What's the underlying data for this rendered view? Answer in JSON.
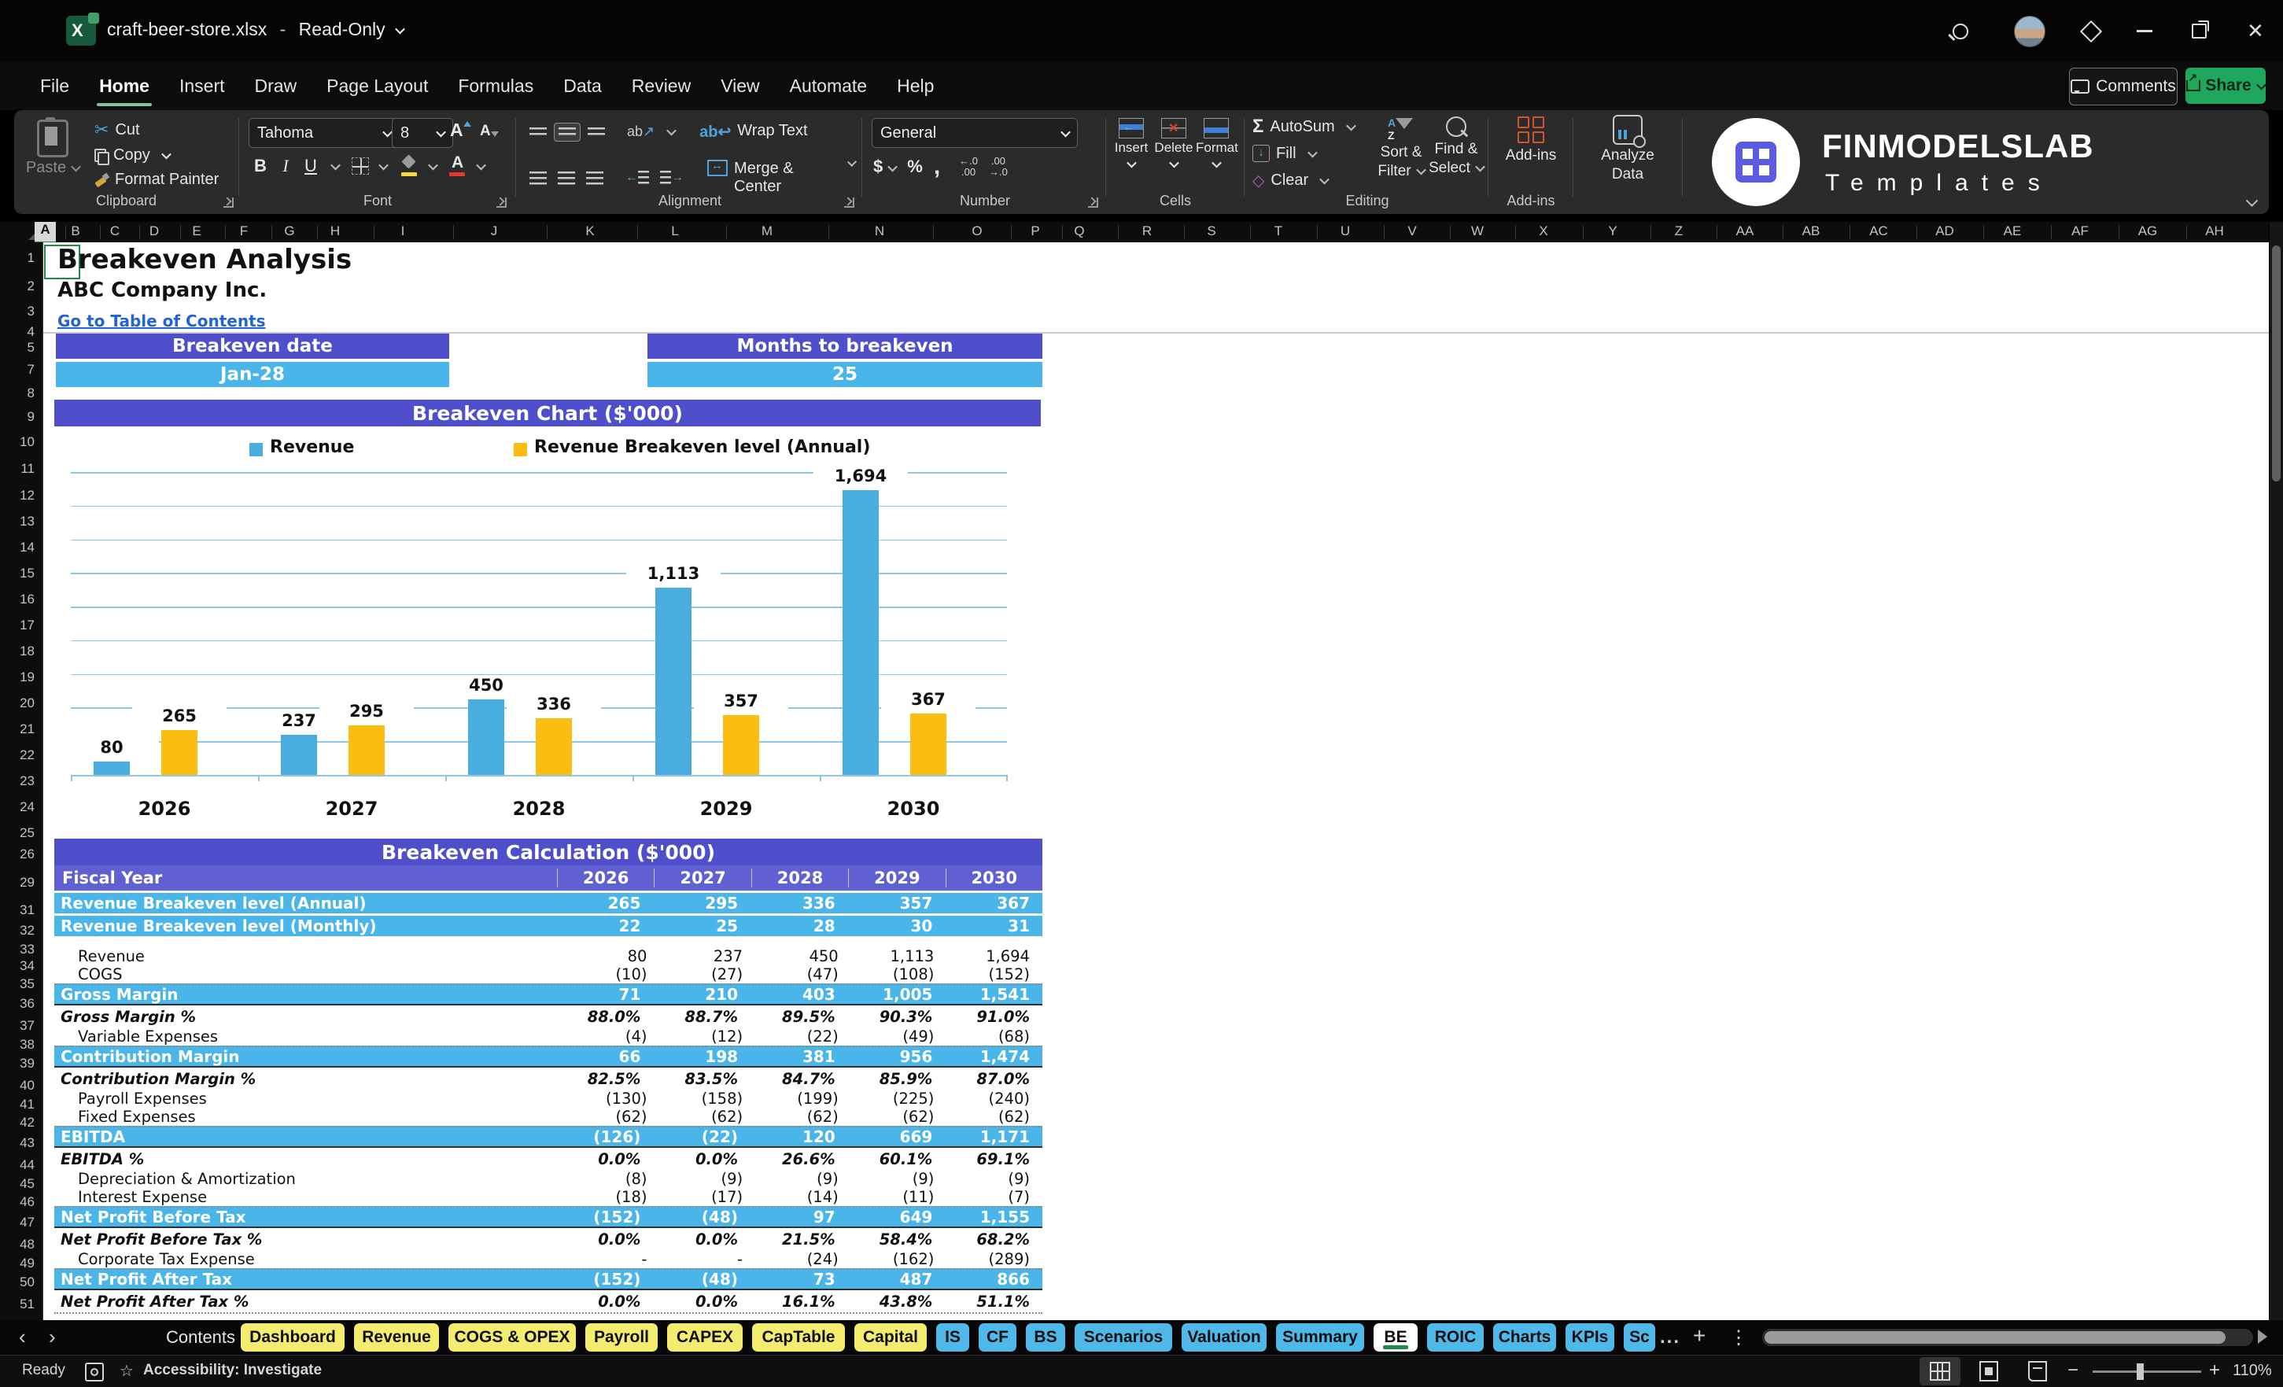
{
  "window": {
    "filename": "craft-beer-store.xlsx",
    "separator": "-",
    "mode": "Read-Only"
  },
  "menu_bar": {
    "items": [
      "File",
      "Home",
      "Insert",
      "Draw",
      "Page Layout",
      "Formulas",
      "Data",
      "Review",
      "View",
      "Automate",
      "Help"
    ],
    "active_item": "Home"
  },
  "quick_actions": {
    "comments_label": "Comments",
    "share_label": "Share"
  },
  "ribbon": {
    "clipboard": {
      "label": "Clipboard",
      "paste": "Paste",
      "cut": "Cut",
      "copy": "Copy",
      "format_painter": "Format Painter"
    },
    "font": {
      "label": "Font",
      "family": "Tahoma",
      "size": "8",
      "bold": "B",
      "italic": "I",
      "underline": "U"
    },
    "alignment": {
      "label": "Alignment",
      "wrap": "Wrap Text",
      "merge": "Merge & Center"
    },
    "number": {
      "label": "Number",
      "format": "General",
      "currency": "$",
      "percent": "%",
      "comma": ","
    },
    "cells": {
      "label": "Cells",
      "insert": "Insert",
      "delete": "Delete",
      "format": "Format"
    },
    "editing": {
      "label": "Editing",
      "autosum": "AutoSum",
      "fill": "Fill",
      "clear": "Clear",
      "sort_line1": "Sort &",
      "sort_line2": "Filter",
      "find_line1": "Find &",
      "find_line2": "Select"
    },
    "addins": {
      "label": "Add-ins",
      "addins": "Add-ins",
      "analyze_line1": "Analyze",
      "analyze_line2": "Data"
    }
  },
  "brand": {
    "name": "FINMODELSLAB",
    "subtitle": "Templates"
  },
  "grid": {
    "column_letters": [
      "A",
      "B",
      "C",
      "D",
      "E",
      "F",
      "G",
      "H",
      "I",
      "J",
      "K",
      "L",
      "M",
      "N",
      "O",
      "P",
      "Q",
      "R",
      "S",
      "T",
      "U",
      "V",
      "W",
      "X",
      "Y",
      "Z",
      "AA",
      "AB",
      "AC",
      "AD",
      "AE",
      "AF",
      "AG",
      "AH"
    ],
    "row_numbers": [
      1,
      2,
      3,
      4,
      5,
      7,
      8,
      9,
      10,
      11,
      12,
      13,
      14,
      15,
      16,
      17,
      18,
      19,
      20,
      21,
      22,
      23,
      24,
      25,
      26,
      29,
      31,
      32,
      33,
      34,
      35,
      36,
      37,
      38,
      39,
      40,
      41,
      42,
      43,
      44,
      45,
      46,
      47,
      48,
      49,
      50,
      51
    ]
  },
  "sheet": {
    "title": "Breakeven Analysis",
    "company": "ABC Company Inc.",
    "toc_link": "Go to Table of Contents",
    "kpis": [
      {
        "label": "Breakeven date",
        "value": "Jan-28"
      },
      {
        "label": "Months to breakeven",
        "value": "25"
      }
    ]
  },
  "chart_data": {
    "type": "bar",
    "title": "Breakeven Chart ($'000)",
    "categories": [
      "2026",
      "2027",
      "2028",
      "2029",
      "2030"
    ],
    "series": [
      {
        "name": "Revenue",
        "color": "#49ADE0",
        "values": [
          80,
          237,
          450,
          1113,
          1694
        ],
        "labels": [
          "80",
          "237",
          "450",
          "1,113",
          "1,694"
        ]
      },
      {
        "name": "Revenue Breakeven level (Annual)",
        "color": "#FBBE10",
        "values": [
          265,
          295,
          336,
          357,
          367
        ],
        "labels": [
          "265",
          "295",
          "336",
          "357",
          "367"
        ]
      }
    ],
    "ylim": [
      0,
      1800
    ],
    "gridline_step": 200,
    "grid": true,
    "legend_position": "top",
    "y_axis_labels": "hidden"
  },
  "calc_table": {
    "title": "Breakeven Calculation ($'000)",
    "header_label": "Fiscal Year",
    "years": [
      "2026",
      "2027",
      "2028",
      "2029",
      "2030"
    ],
    "band_rows": [
      {
        "label": "Revenue Breakeven level (Annual)",
        "values": [
          "265",
          "295",
          "336",
          "357",
          "367"
        ]
      },
      {
        "label": "Revenue Breakeven level (Monthly)",
        "values": [
          "22",
          "25",
          "28",
          "30",
          "31"
        ]
      }
    ],
    "rows": [
      {
        "label": "Revenue",
        "type": "detail",
        "values": [
          "80",
          "237",
          "450",
          "1,113",
          "1,694"
        ]
      },
      {
        "label": "COGS",
        "type": "detail",
        "values": [
          "(10)",
          "(27)",
          "(47)",
          "(108)",
          "(152)"
        ]
      },
      {
        "label": "Gross Margin",
        "type": "subtotal",
        "values": [
          "71",
          "210",
          "403",
          "1,005",
          "1,541"
        ]
      },
      {
        "label": "Gross Margin %",
        "type": "percent",
        "values": [
          "88.0%",
          "88.7%",
          "89.5%",
          "90.3%",
          "91.0%"
        ]
      },
      {
        "label": "Variable Expenses",
        "type": "detail",
        "values": [
          "(4)",
          "(12)",
          "(22)",
          "(49)",
          "(68)"
        ]
      },
      {
        "label": "Contribution Margin",
        "type": "subtotal",
        "values": [
          "66",
          "198",
          "381",
          "956",
          "1,474"
        ]
      },
      {
        "label": "Contribution Margin %",
        "type": "percent",
        "values": [
          "82.5%",
          "83.5%",
          "84.7%",
          "85.9%",
          "87.0%"
        ]
      },
      {
        "label": "Payroll Expenses",
        "type": "detail",
        "values": [
          "(130)",
          "(158)",
          "(199)",
          "(225)",
          "(240)"
        ]
      },
      {
        "label": "Fixed Expenses",
        "type": "detail",
        "values": [
          "(62)",
          "(62)",
          "(62)",
          "(62)",
          "(62)"
        ]
      },
      {
        "label": "EBITDA",
        "type": "subtotal",
        "values": [
          "(126)",
          "(22)",
          "120",
          "669",
          "1,171"
        ]
      },
      {
        "label": "EBITDA %",
        "type": "percent",
        "values": [
          "0.0%",
          "0.0%",
          "26.6%",
          "60.1%",
          "69.1%"
        ]
      },
      {
        "label": "Depreciation & Amortization",
        "type": "detail",
        "values": [
          "(8)",
          "(9)",
          "(9)",
          "(9)",
          "(9)"
        ]
      },
      {
        "label": "Interest Expense",
        "type": "detail",
        "values": [
          "(18)",
          "(17)",
          "(14)",
          "(11)",
          "(7)"
        ]
      },
      {
        "label": "Net Profit Before Tax",
        "type": "subtotal",
        "values": [
          "(152)",
          "(48)",
          "97",
          "649",
          "1,155"
        ]
      },
      {
        "label": "Net Profit Before Tax %",
        "type": "percent",
        "values": [
          "0.0%",
          "0.0%",
          "21.5%",
          "58.4%",
          "68.2%"
        ]
      },
      {
        "label": "Corporate Tax Expense",
        "type": "detail",
        "values": [
          "-",
          "-",
          "(24)",
          "(162)",
          "(289)"
        ]
      },
      {
        "label": "Net Profit After Tax",
        "type": "subtotal",
        "values": [
          "(152)",
          "(48)",
          "73",
          "487",
          "866"
        ]
      },
      {
        "label": "Net Profit After Tax %",
        "type": "percent",
        "values": [
          "0.0%",
          "0.0%",
          "16.1%",
          "43.8%",
          "51.1%"
        ]
      }
    ]
  },
  "sheet_tabs": {
    "tabs": [
      {
        "label": "Contents",
        "style": "plain"
      },
      {
        "label": "Dashboard",
        "style": "yellow"
      },
      {
        "label": "Revenue",
        "style": "yellow"
      },
      {
        "label": "COGS & OPEX",
        "style": "yellow"
      },
      {
        "label": "Payroll",
        "style": "yellow"
      },
      {
        "label": "CAPEX",
        "style": "yellow"
      },
      {
        "label": "CapTable",
        "style": "yellow"
      },
      {
        "label": "Capital",
        "style": "yellow"
      },
      {
        "label": "IS",
        "style": "blue"
      },
      {
        "label": "CF",
        "style": "blue"
      },
      {
        "label": "BS",
        "style": "blue"
      },
      {
        "label": "Scenarios",
        "style": "blue"
      },
      {
        "label": "Valuation",
        "style": "blue"
      },
      {
        "label": "Summary",
        "style": "blue"
      },
      {
        "label": "BE",
        "style": "active"
      },
      {
        "label": "ROIC",
        "style": "blue"
      },
      {
        "label": "Charts",
        "style": "blue"
      },
      {
        "label": "KPIs",
        "style": "blue"
      },
      {
        "label": "Sc",
        "style": "blue"
      }
    ],
    "overflow": "...",
    "add_sheet": "+"
  },
  "status_bar": {
    "ready": "Ready",
    "accessibility": "Accessibility: Investigate",
    "zoom_level": "110%"
  },
  "colors": {
    "accent_purple": "#4F4FCB",
    "accent_purple_light": "#6060D2",
    "accent_blue": "#49B5E8",
    "bar_blue": "#49ADE0",
    "bar_yellow": "#FBBE10",
    "gridline_blue": "#8CC7E9",
    "tab_yellow": "#F3EC6F",
    "tab_blue": "#4FB8E8",
    "share_green": "#1FA85D",
    "link_blue": "#2563CE",
    "active_green": "#1E8A4C"
  }
}
